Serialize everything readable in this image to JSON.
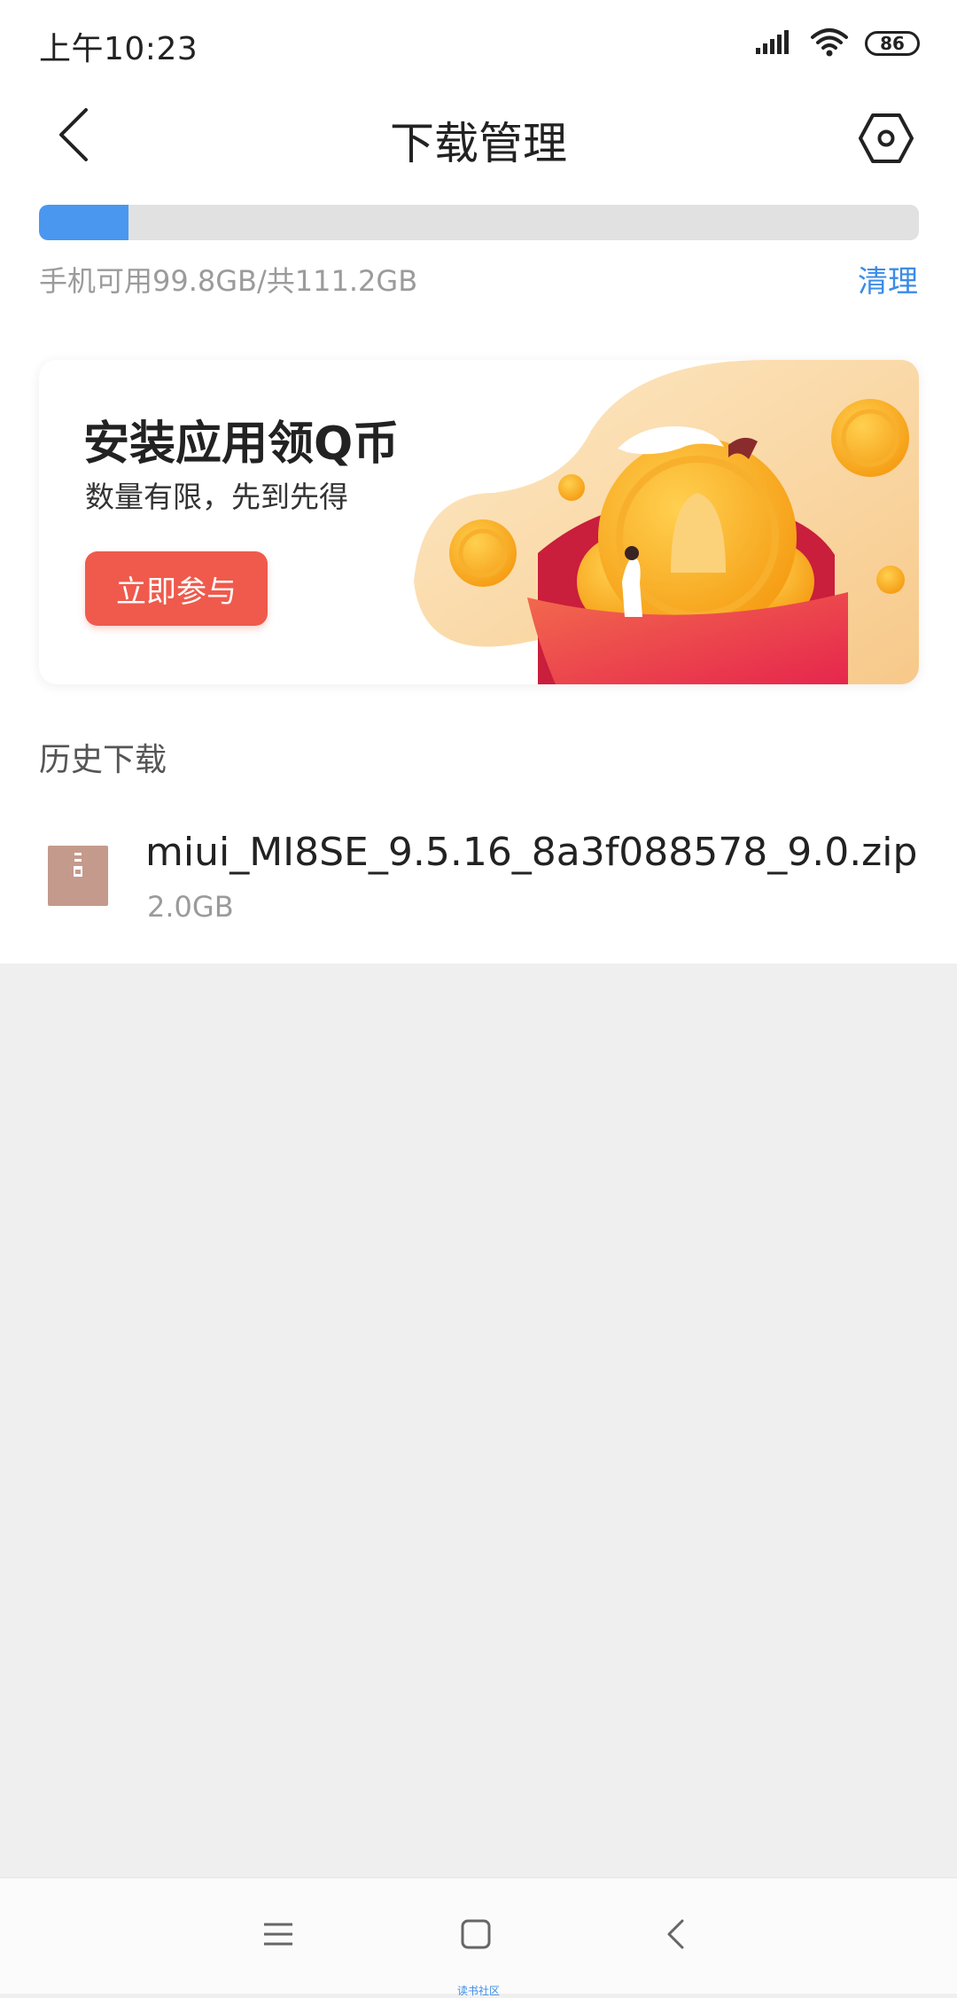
{
  "status_bar": {
    "time": "上午10:23",
    "battery": "86",
    "icons": [
      "signal-icon",
      "wifi-icon",
      "battery-icon"
    ]
  },
  "header": {
    "title": "下载管理",
    "back_icon": "chevron-left-icon",
    "settings_icon": "hexagon-settings-icon"
  },
  "storage": {
    "used_fraction": 0.102,
    "text": "手机可用99.8GB/共111.2GB",
    "clean_label": "清理",
    "fill_color": "#4a97f0"
  },
  "banner": {
    "title": "安装应用领Q币",
    "subtitle": "数量有限，先到先得",
    "button_label": "立即参与",
    "button_color": "#ef5a4c"
  },
  "history": {
    "section_title": "历史下载",
    "items": [
      {
        "name": "miui_MI8SE_9.5.16_8a3f088578_9.0.zip",
        "size": "2.0GB",
        "icon": "zip-file-icon"
      }
    ]
  },
  "nav_bar": {
    "buttons": [
      "menu-icon",
      "home-icon",
      "back-icon"
    ],
    "caption": "读书社区"
  },
  "colors": {
    "accent": "#3b8ce6",
    "background": "#efefef"
  }
}
